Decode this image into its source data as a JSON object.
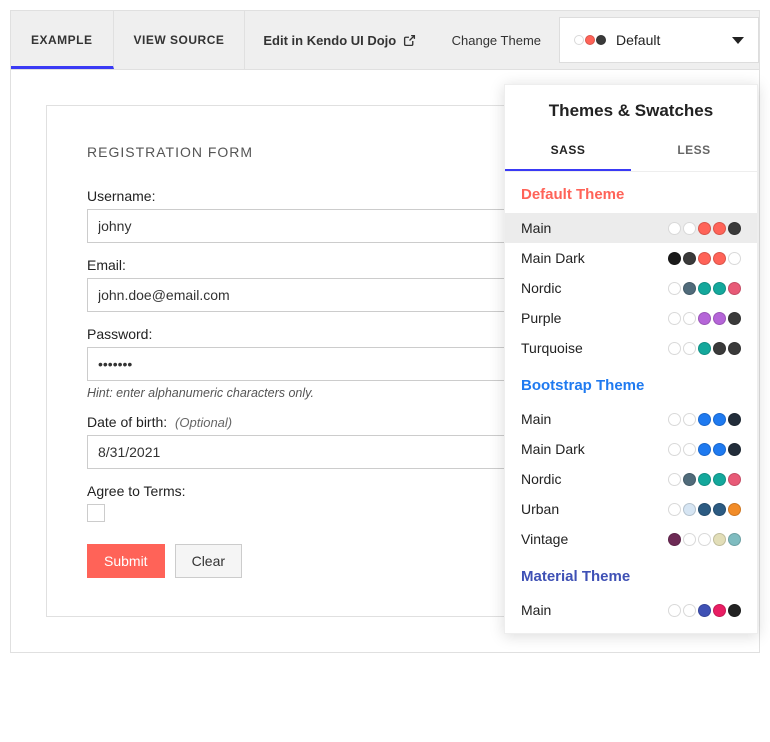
{
  "tabs": {
    "example": "EXAMPLE",
    "viewsource": "VIEW SOURCE",
    "dojo": "Edit in Kendo UI Dojo"
  },
  "theme_select": {
    "label": "Change Theme",
    "current": "Default",
    "dots": [
      "#ffffff",
      "#ff6358",
      "#3a3a3a"
    ]
  },
  "form": {
    "title": "REGISTRATION FORM",
    "username_label": "Username:",
    "username_value": "johny",
    "email_label": "Email:",
    "email_value": "john.doe@email.com",
    "password_label": "Password:",
    "password_value": "•••••••",
    "password_hint": "Hint: enter alphanumeric characters only.",
    "dob_label": "Date of birth:",
    "dob_optional": "(Optional)",
    "dob_value": "8/31/2021",
    "agree_label": "Agree to Terms:",
    "submit": "Submit",
    "clear": "Clear"
  },
  "panel": {
    "title": "Themes & Swatches",
    "tab_sass": "SASS",
    "tab_less": "LESS",
    "section_default": "Default Theme",
    "section_bootstrap": "Bootstrap Theme",
    "section_material": "Material Theme",
    "default_items": [
      {
        "name": "Main",
        "selected": true,
        "dots": [
          "#ffffff",
          "#ffffff",
          "#ff6358",
          "#ff6358",
          "#3a3a3a"
        ]
      },
      {
        "name": "Main Dark",
        "selected": false,
        "dots": [
          "#1a1a1a",
          "#3a3a3a",
          "#ff6358",
          "#ff6358",
          "#ffffff"
        ]
      },
      {
        "name": "Nordic",
        "selected": false,
        "dots": [
          "#ffffff",
          "#506b7a",
          "#14a89c",
          "#14a89c",
          "#e85a77"
        ]
      },
      {
        "name": "Purple",
        "selected": false,
        "dots": [
          "#ffffff",
          "#ffffff",
          "#b565d8",
          "#b565d8",
          "#3a3a3a"
        ]
      },
      {
        "name": "Turquoise",
        "selected": false,
        "dots": [
          "#ffffff",
          "#ffffff",
          "#14a89c",
          "#3a3a3a",
          "#3a3a3a"
        ]
      }
    ],
    "bootstrap_items": [
      {
        "name": "Main",
        "dots": [
          "#ffffff",
          "#ffffff",
          "#1f7af0",
          "#1f7af0",
          "#222d3a"
        ]
      },
      {
        "name": "Main Dark",
        "dots": [
          "#ffffff",
          "#ffffff",
          "#1f7af0",
          "#1f7af0",
          "#222d3a"
        ]
      },
      {
        "name": "Nordic",
        "dots": [
          "#ffffff",
          "#506b7a",
          "#14a89c",
          "#14a89c",
          "#e85a77"
        ]
      },
      {
        "name": "Urban",
        "dots": [
          "#ffffff",
          "#d6e5f3",
          "#2c5b82",
          "#2c5b82",
          "#f28c28"
        ]
      },
      {
        "name": "Vintage",
        "dots": [
          "#6d2a55",
          "#ffffff",
          "#ffffff",
          "#e2deb8",
          "#7fbcc0"
        ]
      }
    ],
    "material_items": [
      {
        "name": "Main",
        "dots": [
          "#ffffff",
          "#ffffff",
          "#3f51b5",
          "#e91e63",
          "#222222"
        ]
      }
    ]
  }
}
